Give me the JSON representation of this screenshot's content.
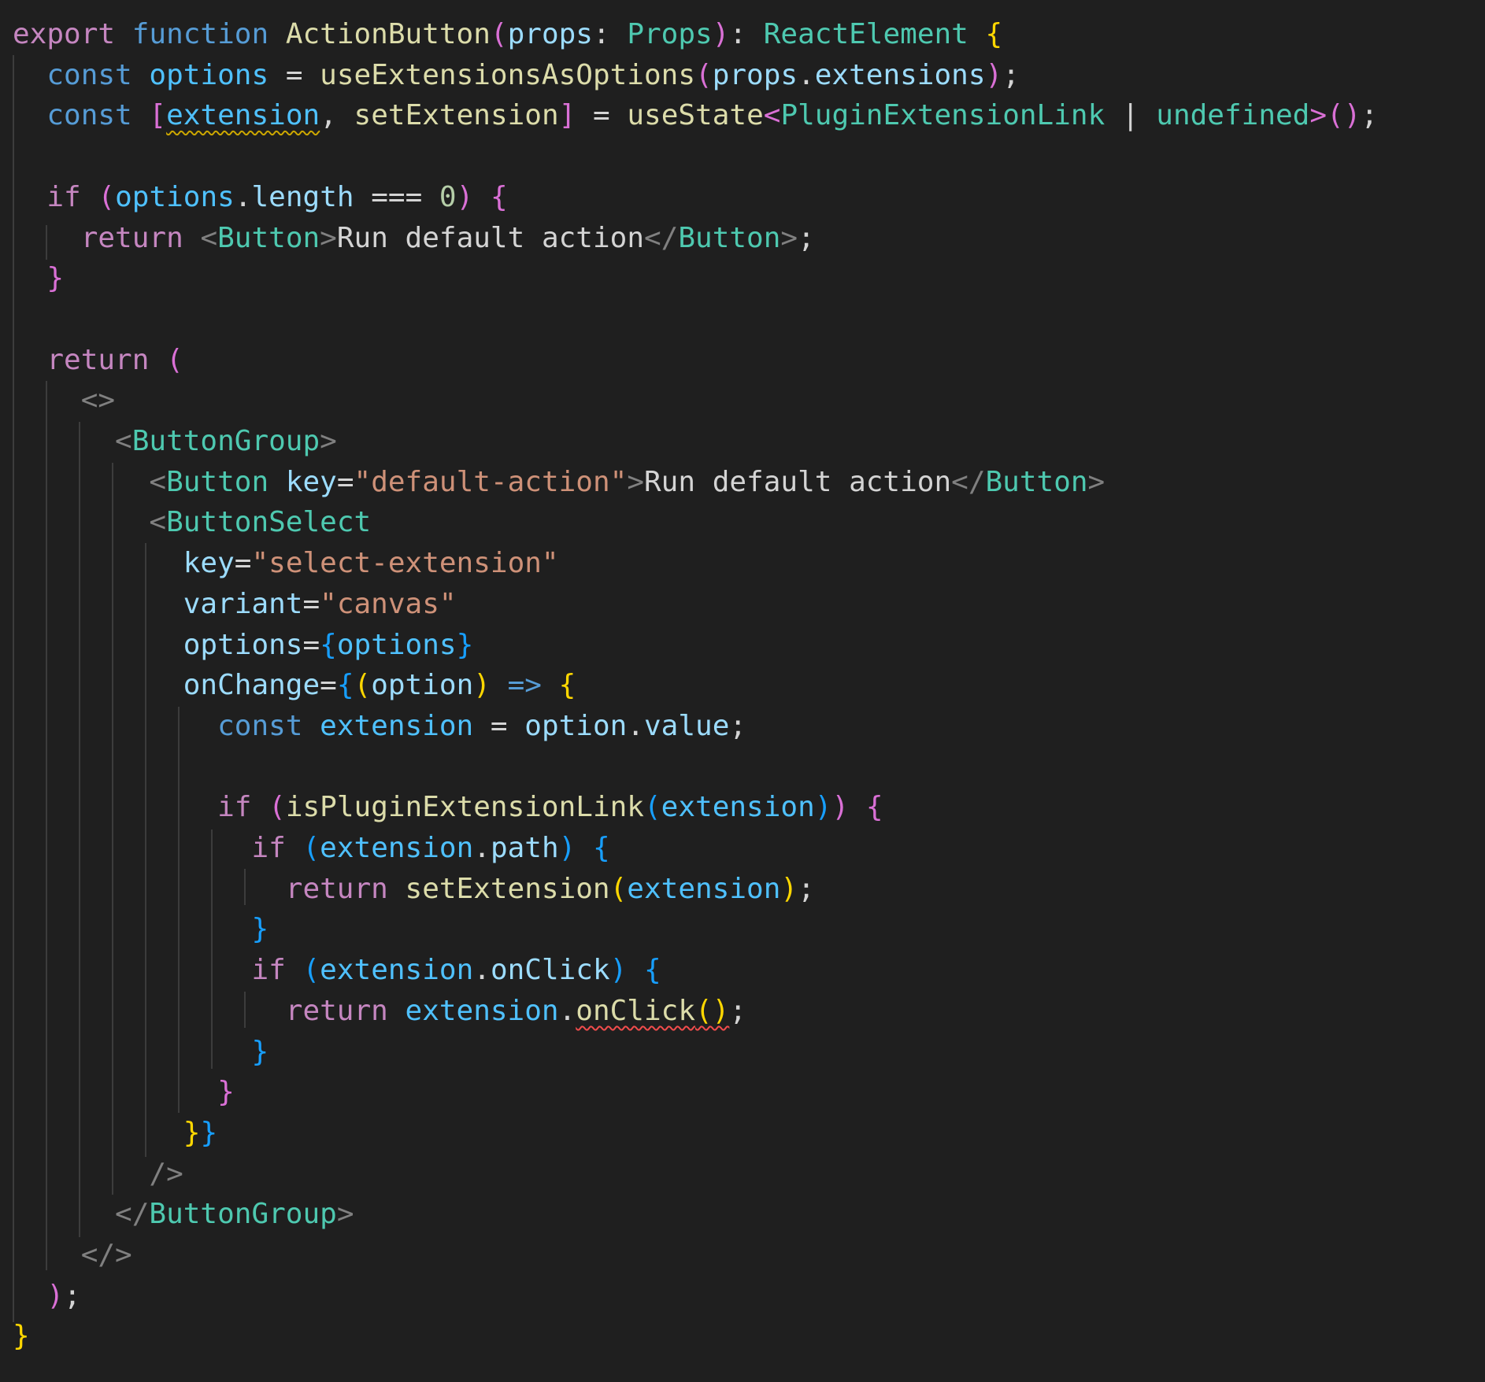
{
  "colors": {
    "background": "#1f1f1f",
    "text": "#d4d4d4",
    "keyword_purple": "#c586c0",
    "keyword_blue": "#569cd6",
    "function_yellow": "#dcdcaa",
    "variable": "#9cdcfe",
    "type_teal": "#4ec9b0",
    "string": "#ce9178",
    "number": "#b5cea8",
    "bracket_gold": "#ffd700",
    "bracket_orchid": "#da70d6",
    "bracket_blue": "#179fff",
    "punctuation_gray": "#808080",
    "indent_guide": "#3c3c3c",
    "warning_squiggle": "#cca700",
    "error_squiggle": "#f14c4c"
  },
  "code_lines": [
    {
      "tokens": [
        {
          "text": "export",
          "color": "#c586c0"
        },
        {
          "text": " "
        },
        {
          "text": "function",
          "color": "#569cd6"
        },
        {
          "text": " "
        },
        {
          "text": "ActionButton",
          "color": "#dcdcaa"
        },
        {
          "text": "(",
          "color": "#da70d6"
        },
        {
          "text": "props",
          "color": "#9cdcfe"
        },
        {
          "text": ": "
        },
        {
          "text": "Props",
          "color": "#4ec9b0"
        },
        {
          "text": ")",
          "color": "#da70d6"
        },
        {
          "text": ": "
        },
        {
          "text": "ReactElement",
          "color": "#4ec9b0"
        },
        {
          "text": " "
        },
        {
          "text": "{",
          "color": "#ffd700"
        }
      ]
    },
    {
      "tokens": [
        {
          "text": "  "
        },
        {
          "text": "const",
          "color": "#569cd6"
        },
        {
          "text": " "
        },
        {
          "text": "options",
          "color": "#4fc1ff"
        },
        {
          "text": " = "
        },
        {
          "text": "useExtensionsAsOptions",
          "color": "#dcdcaa"
        },
        {
          "text": "(",
          "color": "#da70d6"
        },
        {
          "text": "props",
          "color": "#9cdcfe"
        },
        {
          "text": "."
        },
        {
          "text": "extensions",
          "color": "#9cdcfe"
        },
        {
          "text": ")",
          "color": "#da70d6"
        },
        {
          "text": ";"
        }
      ]
    },
    {
      "tokens": [
        {
          "text": "  "
        },
        {
          "text": "const",
          "color": "#569cd6"
        },
        {
          "text": " "
        },
        {
          "text": "[",
          "color": "#da70d6"
        },
        {
          "text": "extension",
          "color": "#4fc1ff",
          "squiggle": "warning"
        },
        {
          "text": ", "
        },
        {
          "text": "setExtension",
          "color": "#dcdcaa"
        },
        {
          "text": "]",
          "color": "#da70d6"
        },
        {
          "text": " = "
        },
        {
          "text": "useState",
          "color": "#dcdcaa"
        },
        {
          "text": "<",
          "color": "#da70d6"
        },
        {
          "text": "PluginExtensionLink",
          "color": "#4ec9b0"
        },
        {
          "text": " | "
        },
        {
          "text": "undefined",
          "color": "#4ec9b0"
        },
        {
          "text": ">",
          "color": "#da70d6"
        },
        {
          "text": "()",
          "color": "#da70d6"
        },
        {
          "text": ";"
        }
      ]
    },
    {
      "tokens": []
    },
    {
      "tokens": [
        {
          "text": "  "
        },
        {
          "text": "if",
          "color": "#c586c0"
        },
        {
          "text": " "
        },
        {
          "text": "(",
          "color": "#da70d6"
        },
        {
          "text": "options",
          "color": "#4fc1ff"
        },
        {
          "text": "."
        },
        {
          "text": "length",
          "color": "#9cdcfe"
        },
        {
          "text": " === "
        },
        {
          "text": "0",
          "color": "#b5cea8"
        },
        {
          "text": ")",
          "color": "#da70d6"
        },
        {
          "text": " "
        },
        {
          "text": "{",
          "color": "#da70d6"
        }
      ]
    },
    {
      "tokens": [
        {
          "text": "    "
        },
        {
          "text": "return",
          "color": "#c586c0"
        },
        {
          "text": " "
        },
        {
          "text": "<",
          "color": "#808080"
        },
        {
          "text": "Button",
          "color": "#4ec9b0"
        },
        {
          "text": ">",
          "color": "#808080"
        },
        {
          "text": "Run default action"
        },
        {
          "text": "</",
          "color": "#808080"
        },
        {
          "text": "Button",
          "color": "#4ec9b0"
        },
        {
          "text": ">",
          "color": "#808080"
        },
        {
          "text": ";"
        }
      ]
    },
    {
      "tokens": [
        {
          "text": "  "
        },
        {
          "text": "}",
          "color": "#da70d6"
        }
      ]
    },
    {
      "tokens": []
    },
    {
      "tokens": [
        {
          "text": "  "
        },
        {
          "text": "return",
          "color": "#c586c0"
        },
        {
          "text": " "
        },
        {
          "text": "(",
          "color": "#da70d6"
        }
      ]
    },
    {
      "tokens": [
        {
          "text": "    "
        },
        {
          "text": "<>",
          "color": "#808080"
        }
      ]
    },
    {
      "tokens": [
        {
          "text": "      "
        },
        {
          "text": "<",
          "color": "#808080"
        },
        {
          "text": "ButtonGroup",
          "color": "#4ec9b0"
        },
        {
          "text": ">",
          "color": "#808080"
        }
      ]
    },
    {
      "tokens": [
        {
          "text": "        "
        },
        {
          "text": "<",
          "color": "#808080"
        },
        {
          "text": "Button",
          "color": "#4ec9b0"
        },
        {
          "text": " "
        },
        {
          "text": "key",
          "color": "#9cdcfe"
        },
        {
          "text": "="
        },
        {
          "text": "\"default-action\"",
          "color": "#ce9178"
        },
        {
          "text": ">",
          "color": "#808080"
        },
        {
          "text": "Run default action"
        },
        {
          "text": "</",
          "color": "#808080"
        },
        {
          "text": "Button",
          "color": "#4ec9b0"
        },
        {
          "text": ">",
          "color": "#808080"
        }
      ]
    },
    {
      "tokens": [
        {
          "text": "        "
        },
        {
          "text": "<",
          "color": "#808080"
        },
        {
          "text": "ButtonSelect",
          "color": "#4ec9b0"
        }
      ]
    },
    {
      "tokens": [
        {
          "text": "          "
        },
        {
          "text": "key",
          "color": "#9cdcfe"
        },
        {
          "text": "="
        },
        {
          "text": "\"select-extension\"",
          "color": "#ce9178"
        }
      ]
    },
    {
      "tokens": [
        {
          "text": "          "
        },
        {
          "text": "variant",
          "color": "#9cdcfe"
        },
        {
          "text": "="
        },
        {
          "text": "\"canvas\"",
          "color": "#ce9178"
        }
      ]
    },
    {
      "tokens": [
        {
          "text": "          "
        },
        {
          "text": "options",
          "color": "#9cdcfe"
        },
        {
          "text": "="
        },
        {
          "text": "{",
          "color": "#179fff"
        },
        {
          "text": "options",
          "color": "#4fc1ff"
        },
        {
          "text": "}",
          "color": "#179fff"
        }
      ]
    },
    {
      "tokens": [
        {
          "text": "          "
        },
        {
          "text": "onChange",
          "color": "#9cdcfe"
        },
        {
          "text": "="
        },
        {
          "text": "{",
          "color": "#179fff"
        },
        {
          "text": "(",
          "color": "#ffd700"
        },
        {
          "text": "option",
          "color": "#9cdcfe"
        },
        {
          "text": ")",
          "color": "#ffd700"
        },
        {
          "text": " "
        },
        {
          "text": "=>",
          "color": "#569cd6"
        },
        {
          "text": " "
        },
        {
          "text": "{",
          "color": "#ffd700"
        }
      ]
    },
    {
      "tokens": [
        {
          "text": "            "
        },
        {
          "text": "const",
          "color": "#569cd6"
        },
        {
          "text": " "
        },
        {
          "text": "extension",
          "color": "#4fc1ff"
        },
        {
          "text": " = "
        },
        {
          "text": "option",
          "color": "#9cdcfe"
        },
        {
          "text": "."
        },
        {
          "text": "value",
          "color": "#9cdcfe"
        },
        {
          "text": ";"
        }
      ]
    },
    {
      "tokens": []
    },
    {
      "tokens": [
        {
          "text": "            "
        },
        {
          "text": "if",
          "color": "#c586c0"
        },
        {
          "text": " "
        },
        {
          "text": "(",
          "color": "#da70d6"
        },
        {
          "text": "isPluginExtensionLink",
          "color": "#dcdcaa"
        },
        {
          "text": "(",
          "color": "#179fff"
        },
        {
          "text": "extension",
          "color": "#4fc1ff"
        },
        {
          "text": ")",
          "color": "#179fff"
        },
        {
          "text": ")",
          "color": "#da70d6"
        },
        {
          "text": " "
        },
        {
          "text": "{",
          "color": "#da70d6"
        }
      ]
    },
    {
      "tokens": [
        {
          "text": "              "
        },
        {
          "text": "if",
          "color": "#c586c0"
        },
        {
          "text": " "
        },
        {
          "text": "(",
          "color": "#179fff"
        },
        {
          "text": "extension",
          "color": "#4fc1ff"
        },
        {
          "text": "."
        },
        {
          "text": "path",
          "color": "#9cdcfe"
        },
        {
          "text": ")",
          "color": "#179fff"
        },
        {
          "text": " "
        },
        {
          "text": "{",
          "color": "#179fff"
        }
      ]
    },
    {
      "tokens": [
        {
          "text": "                "
        },
        {
          "text": "return",
          "color": "#c586c0"
        },
        {
          "text": " "
        },
        {
          "text": "setExtension",
          "color": "#dcdcaa"
        },
        {
          "text": "(",
          "color": "#ffd700"
        },
        {
          "text": "extension",
          "color": "#4fc1ff"
        },
        {
          "text": ")",
          "color": "#ffd700"
        },
        {
          "text": ";"
        }
      ]
    },
    {
      "tokens": [
        {
          "text": "              "
        },
        {
          "text": "}",
          "color": "#179fff"
        }
      ]
    },
    {
      "tokens": [
        {
          "text": "              "
        },
        {
          "text": "if",
          "color": "#c586c0"
        },
        {
          "text": " "
        },
        {
          "text": "(",
          "color": "#179fff"
        },
        {
          "text": "extension",
          "color": "#4fc1ff"
        },
        {
          "text": "."
        },
        {
          "text": "onClick",
          "color": "#9cdcfe"
        },
        {
          "text": ")",
          "color": "#179fff"
        },
        {
          "text": " "
        },
        {
          "text": "{",
          "color": "#179fff"
        }
      ]
    },
    {
      "tokens": [
        {
          "text": "                "
        },
        {
          "text": "return",
          "color": "#c586c0"
        },
        {
          "text": " "
        },
        {
          "text": "extension",
          "color": "#4fc1ff"
        },
        {
          "text": "."
        },
        {
          "text": "onClick",
          "color": "#dcdcaa",
          "squiggle": "error"
        },
        {
          "text": "()",
          "color": "#ffd700",
          "squiggle": "error"
        },
        {
          "text": ";"
        }
      ]
    },
    {
      "tokens": [
        {
          "text": "              "
        },
        {
          "text": "}",
          "color": "#179fff"
        }
      ]
    },
    {
      "tokens": [
        {
          "text": "            "
        },
        {
          "text": "}",
          "color": "#da70d6"
        }
      ]
    },
    {
      "tokens": [
        {
          "text": "          "
        },
        {
          "text": "}",
          "color": "#ffd700"
        },
        {
          "text": "}",
          "color": "#179fff"
        }
      ]
    },
    {
      "tokens": [
        {
          "text": "        "
        },
        {
          "text": "/>",
          "color": "#808080"
        }
      ]
    },
    {
      "tokens": [
        {
          "text": "      "
        },
        {
          "text": "</",
          "color": "#808080"
        },
        {
          "text": "ButtonGroup",
          "color": "#4ec9b0"
        },
        {
          "text": ">",
          "color": "#808080"
        }
      ]
    },
    {
      "tokens": [
        {
          "text": "    "
        },
        {
          "text": "</>",
          "color": "#808080"
        }
      ]
    },
    {
      "tokens": [
        {
          "text": "  "
        },
        {
          "text": ")",
          "color": "#da70d6"
        },
        {
          "text": ";"
        }
      ]
    },
    {
      "tokens": [
        {
          "text": "}",
          "color": "#ffd700"
        }
      ]
    }
  ]
}
